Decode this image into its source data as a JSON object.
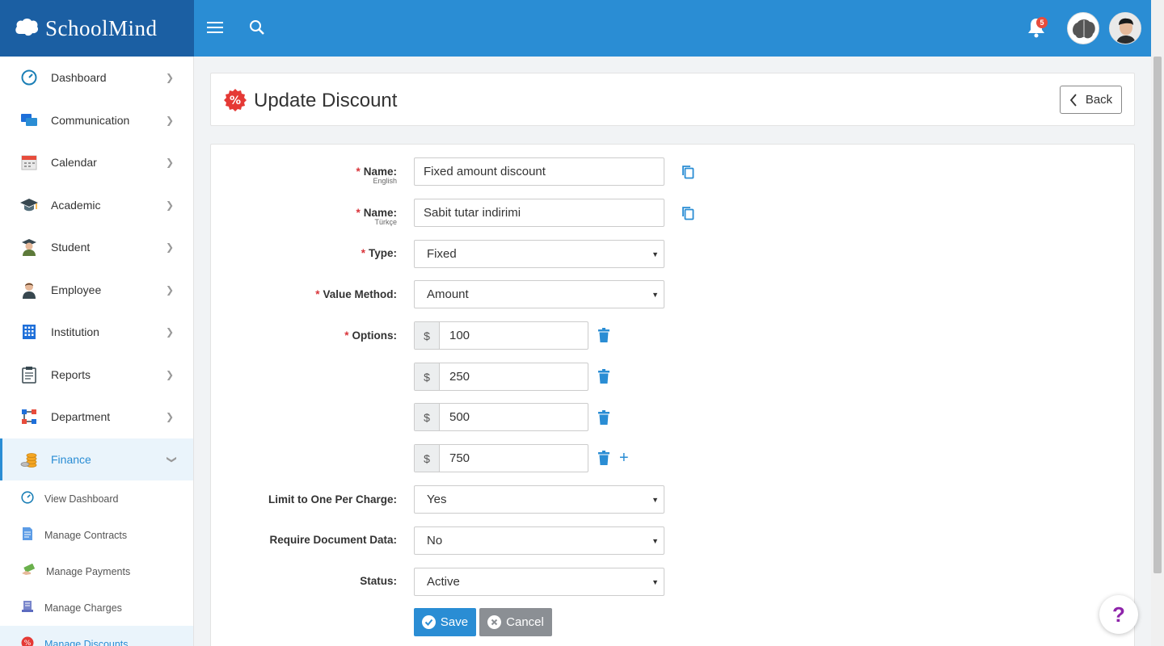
{
  "brand": {
    "name": "SchoolMind"
  },
  "topbar": {
    "notification_count": "5"
  },
  "sidebar": {
    "items": [
      {
        "label": "Dashboard",
        "icon": "dashboard-icon"
      },
      {
        "label": "Communication",
        "icon": "chat-icon"
      },
      {
        "label": "Calendar",
        "icon": "calendar-icon"
      },
      {
        "label": "Academic",
        "icon": "graduation-cap-icon"
      },
      {
        "label": "Student",
        "icon": "student-icon"
      },
      {
        "label": "Employee",
        "icon": "employee-icon"
      },
      {
        "label": "Institution",
        "icon": "building-icon"
      },
      {
        "label": "Reports",
        "icon": "clipboard-icon"
      },
      {
        "label": "Department",
        "icon": "org-chart-icon"
      },
      {
        "label": "Finance",
        "icon": "coins-icon",
        "active": true
      }
    ],
    "finance_sub": [
      {
        "label": "View Dashboard"
      },
      {
        "label": "Manage Contracts"
      },
      {
        "label": "Manage Payments"
      },
      {
        "label": "Manage Charges"
      },
      {
        "label": "Manage Discounts"
      }
    ]
  },
  "header": {
    "title": "Update Discount",
    "back_label": "Back"
  },
  "form": {
    "name_label": "Name:",
    "name_en_sub": "English",
    "name_en_value": "Fixed amount discount",
    "name_tr_sub": "Türkçe",
    "name_tr_value": "Sabit tutar indirimi",
    "type_label": "Type:",
    "type_value": "Fixed",
    "value_method_label": "Value Method:",
    "value_method_value": "Amount",
    "options_label": "Options:",
    "currency": "$",
    "options": [
      "100",
      "250",
      "500",
      "750"
    ],
    "limit_label": "Limit to One Per Charge:",
    "limit_value": "Yes",
    "require_doc_label": "Require Document Data:",
    "require_doc_value": "No",
    "status_label": "Status:",
    "status_value": "Active",
    "save_label": "Save",
    "cancel_label": "Cancel"
  },
  "help": {
    "label": "?"
  },
  "colors": {
    "primary": "#2a8dd4",
    "brand_dark": "#1b5fa3",
    "required": "#d9343a"
  }
}
